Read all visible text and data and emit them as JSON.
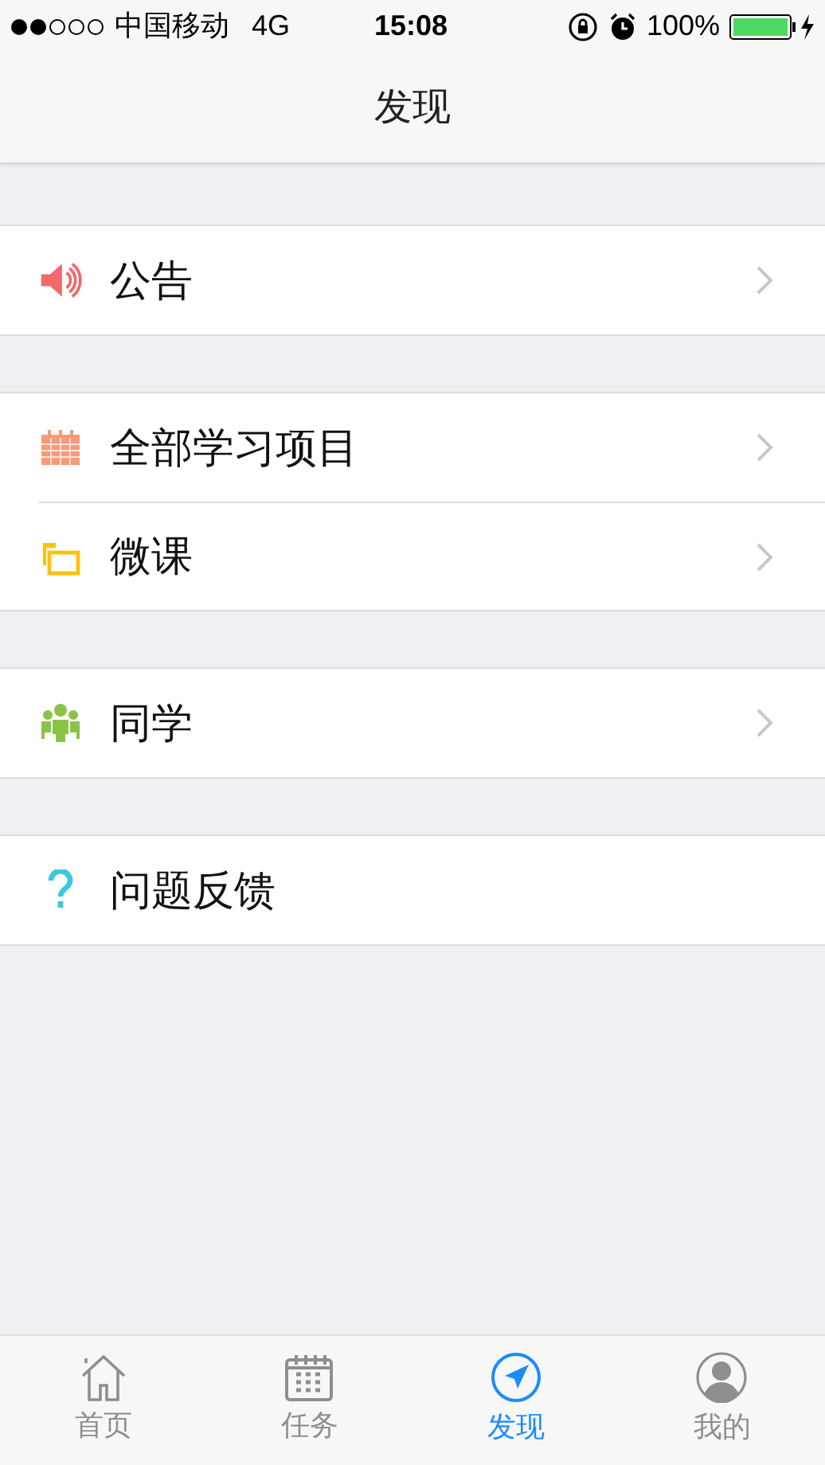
{
  "status_bar": {
    "carrier": "中国移动",
    "network": "4G",
    "time": "15:08",
    "battery": "100%"
  },
  "nav_bar": {
    "title": "发现"
  },
  "groups": [
    {
      "items": [
        {
          "label": "公告",
          "chevron": true
        }
      ]
    },
    {
      "items": [
        {
          "label": "全部学习项目",
          "chevron": true
        },
        {
          "label": "微课",
          "chevron": true
        }
      ]
    },
    {
      "items": [
        {
          "label": "同学",
          "chevron": true
        }
      ]
    },
    {
      "items": [
        {
          "label": "问题反馈",
          "chevron": false
        }
      ]
    }
  ],
  "tab_bar": [
    {
      "label": "首页",
      "selected": false
    },
    {
      "label": "任务",
      "selected": false
    },
    {
      "label": "发现",
      "selected": true
    },
    {
      "label": "我的",
      "selected": false
    }
  ]
}
